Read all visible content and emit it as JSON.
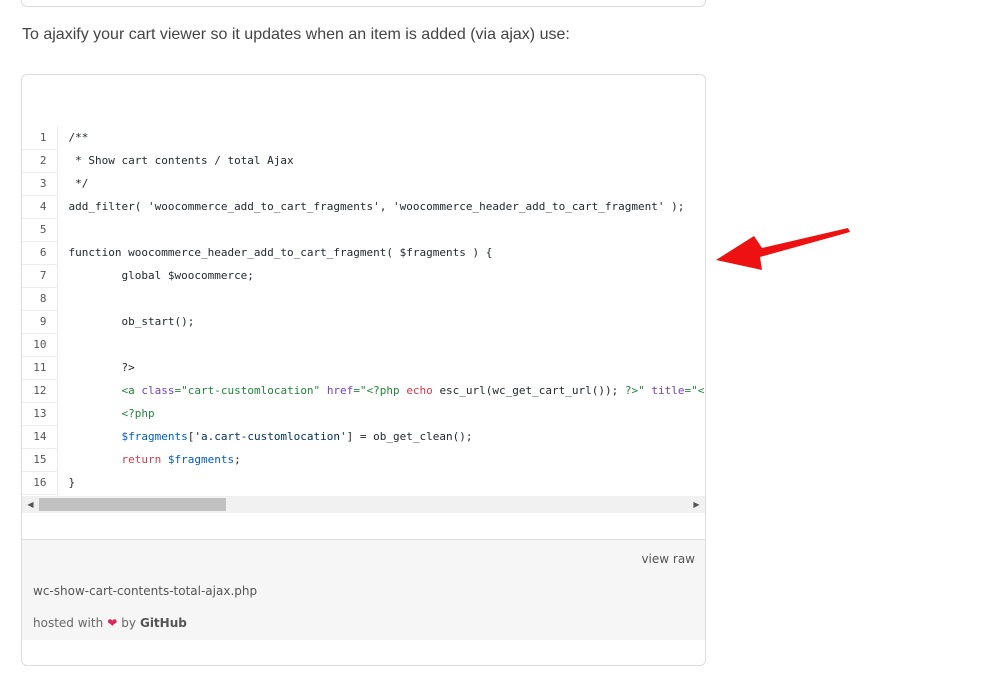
{
  "intro_text": "To ajaxify your cart viewer so it updates when an item is added (via ajax) use:",
  "gist": {
    "lines": [
      {
        "num": "1",
        "tokens": [
          {
            "t": "/**",
            "c": ""
          }
        ]
      },
      {
        "num": "2",
        "tokens": [
          {
            "t": " * Show cart contents / total Ajax",
            "c": ""
          }
        ]
      },
      {
        "num": "3",
        "tokens": [
          {
            "t": " */",
            "c": ""
          }
        ]
      },
      {
        "num": "4",
        "tokens": [
          {
            "t": "add_filter( 'woocommerce_add_to_cart_fragments', 'woocommerce_header_add_to_cart_fragment' );",
            "c": ""
          }
        ]
      },
      {
        "num": "5",
        "tokens": []
      },
      {
        "num": "6",
        "tokens": [
          {
            "t": "function woocommerce_header_add_to_cart_fragment( $fragments ) {",
            "c": ""
          }
        ]
      },
      {
        "num": "7",
        "tokens": [
          {
            "t": "        global $woocommerce;",
            "c": ""
          }
        ]
      },
      {
        "num": "8",
        "tokens": []
      },
      {
        "num": "9",
        "tokens": [
          {
            "t": "        ob_start();",
            "c": ""
          }
        ]
      },
      {
        "num": "10",
        "tokens": []
      },
      {
        "num": "11",
        "tokens": [
          {
            "t": "        ?>",
            "c": ""
          }
        ]
      },
      {
        "num": "12",
        "tokens": [
          {
            "t": "        ",
            "c": ""
          },
          {
            "t": "<a ",
            "c": "tok-t"
          },
          {
            "t": "class",
            "c": "tok-a"
          },
          {
            "t": "=\"cart-customlocation\" ",
            "c": "tok-t"
          },
          {
            "t": "href",
            "c": "tok-a"
          },
          {
            "t": "=\"",
            "c": "tok-t"
          },
          {
            "t": "<?php ",
            "c": "tok-t"
          },
          {
            "t": "echo ",
            "c": "tok-k"
          },
          {
            "t": "esc_url(wc_get_cart_url()); ",
            "c": ""
          },
          {
            "t": "?>",
            "c": "tok-t"
          },
          {
            "t": "\" ",
            "c": "tok-t"
          },
          {
            "t": "title",
            "c": "tok-a"
          },
          {
            "t": "=\"<?",
            "c": "tok-t"
          }
        ]
      },
      {
        "num": "13",
        "tokens": [
          {
            "t": "        ",
            "c": ""
          },
          {
            "t": "<?php",
            "c": "tok-t"
          }
        ]
      },
      {
        "num": "14",
        "tokens": [
          {
            "t": "        ",
            "c": ""
          },
          {
            "t": "$fragments",
            "c": "tok-n"
          },
          {
            "t": "[",
            "c": ""
          },
          {
            "t": "'a.cart-customlocation'",
            "c": "tok-s"
          },
          {
            "t": "] = ob_get_clean();",
            "c": ""
          }
        ]
      },
      {
        "num": "15",
        "tokens": [
          {
            "t": "        ",
            "c": ""
          },
          {
            "t": "return ",
            "c": "tok-k"
          },
          {
            "t": "$fragments",
            "c": "tok-n"
          },
          {
            "t": ";",
            "c": ""
          }
        ]
      },
      {
        "num": "16",
        "tokens": [
          {
            "t": "}",
            "c": ""
          }
        ]
      }
    ],
    "view_raw": "view raw",
    "filename": "wc-show-cart-contents-total-ajax.php",
    "hosted_prefix": "hosted with",
    "hosted_by": "by",
    "hosted_brand": "GitHub",
    "heart_icon": "heart-icon"
  },
  "colors": {
    "arrow": "#ee1111",
    "heart": "#e0245e",
    "tag": "#22863a",
    "attr": "#6f42c1",
    "keyword": "#d73a49"
  }
}
